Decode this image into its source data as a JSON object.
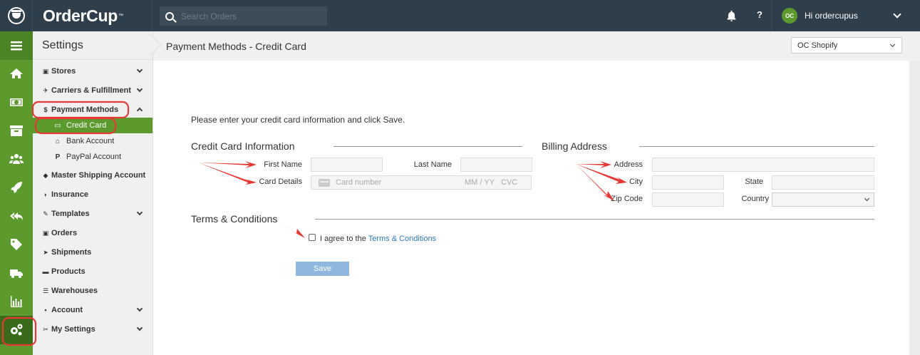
{
  "app": {
    "brand": "OrderCup",
    "brand_tm": "™"
  },
  "topbar": {
    "search_placeholder": "Search Orders",
    "help_label": "?",
    "user_initials": "OC",
    "user_greeting": "Hi ordercupus"
  },
  "rail": {
    "items": [
      "menu-icon",
      "home-icon",
      "money-icon",
      "archive-icon",
      "users-icon",
      "rocket-icon",
      "reply-icon",
      "tag-icon",
      "truck-icon",
      "chart-icon",
      "settings-icon"
    ]
  },
  "sidebar": {
    "title": "Settings",
    "items": [
      {
        "label": "Stores",
        "icon": "🎁"
      },
      {
        "label": "Carriers & Fulfillment",
        "icon": "✈"
      },
      {
        "label": "Payment Methods",
        "icon": "$"
      },
      {
        "label": "Master Shipping Account",
        "icon": "🎓"
      },
      {
        "label": "Insurance",
        "icon": "⛉"
      },
      {
        "label": "Templates",
        "icon": "✎"
      },
      {
        "label": "Orders",
        "icon": "▣"
      },
      {
        "label": "Shipments",
        "icon": "➤"
      },
      {
        "label": "Products",
        "icon": "▬"
      },
      {
        "label": "Warehouses",
        "icon": "☰"
      },
      {
        "label": "Account",
        "icon": "▪"
      },
      {
        "label": "My Settings",
        "icon": "🔧"
      }
    ],
    "sub_items": [
      {
        "label": "Credit Card",
        "icon": "▭"
      },
      {
        "label": "Bank Account",
        "icon": "🏛"
      },
      {
        "label": "PayPal Account",
        "icon": "P"
      }
    ]
  },
  "header": {
    "title": "Payment Methods - Credit Card",
    "store_selected": "OC Shopify"
  },
  "form": {
    "intro": "Please enter your credit card information and click Save.",
    "cc_heading": "Credit Card Information",
    "billing_heading": "Billing Address",
    "terms_heading": "Terms & Conditions",
    "first_name_label": "First Name",
    "last_name_label": "Last Name",
    "card_details_label": "Card Details",
    "card_number_placeholder": "Card number",
    "card_expiry_placeholder": "MM / YY",
    "card_cvc_placeholder": "CVC",
    "address_label": "Address",
    "city_label": "City",
    "state_label": "State",
    "zip_label": "Zip Code",
    "country_label": "Country",
    "agree_prefix": "I agree to the ",
    "agree_link": "Terms & Conditions",
    "save_label": "Save"
  },
  "colors": {
    "topbar": "#2f3e4b",
    "rail": "#5c9a2d",
    "accent_green": "#5c9a2d",
    "link": "#2a7ab8",
    "save_button": "#8fb7de",
    "annotation_red": "#e53935"
  }
}
